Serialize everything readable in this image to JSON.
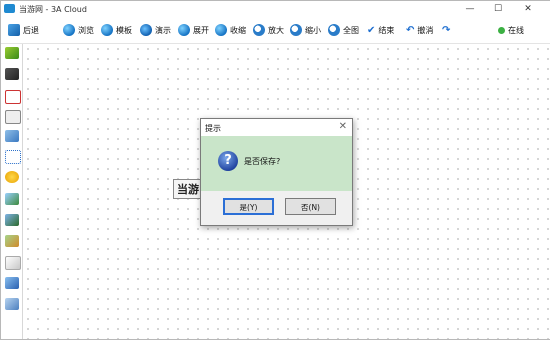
{
  "window": {
    "title": "当游网 - 3A Cloud",
    "controls": [
      "—",
      "☐",
      "✕"
    ]
  },
  "toolbar": {
    "back": "后退",
    "browse": "浏览",
    "template": "模板",
    "present": "演示",
    "expand": "展开",
    "collapse": "收缩",
    "zoom_in": "放大",
    "zoom_out": "缩小",
    "fit_all": "全图",
    "finish": "结束",
    "undo": "撤消",
    "online": "在线"
  },
  "canvas": {
    "node_text": "当游"
  },
  "dialog": {
    "title": "提示",
    "close": "✕",
    "question_mark": "?",
    "message": "是否保存?",
    "yes_label": "是(Y)",
    "no_label": "否(N)"
  },
  "colors": {
    "dialog_body": "#c9e5c9",
    "accent_blue": "#1f8ad1",
    "online_dot": "#3cb043"
  }
}
